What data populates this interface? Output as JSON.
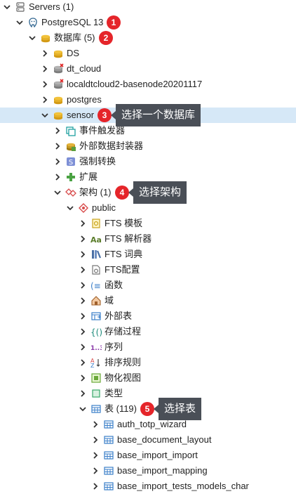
{
  "rows": [
    {
      "label": "Servers (1)",
      "icon": "servers-icon",
      "level": 0,
      "chev": "down"
    },
    {
      "label": "PostgreSQL 13",
      "icon": "postgresql-server-icon",
      "level": 1,
      "chev": "down"
    },
    {
      "label": "数据库 (5)",
      "icon": "databases-icon",
      "level": 2,
      "chev": "down"
    },
    {
      "label": "DS",
      "icon": "database-icon",
      "level": 3,
      "chev": "right"
    },
    {
      "label": "dt_cloud",
      "icon": "database-disconnected-icon",
      "level": 3,
      "chev": "right"
    },
    {
      "label": "localdtcloud2-basenode20201117",
      "icon": "database-disconnected-icon",
      "level": 3,
      "chev": "right"
    },
    {
      "label": "postgres",
      "icon": "database-icon",
      "level": 3,
      "chev": "right"
    },
    {
      "label": "sensor",
      "icon": "database-icon",
      "level": 3,
      "chev": "down",
      "selected": true
    },
    {
      "label": "事件触发器",
      "icon": "event-trigger-icon",
      "level": 4,
      "chev": "right"
    },
    {
      "label": "外部数据封装器",
      "icon": "foreign-data-wrapper-icon",
      "level": 4,
      "chev": "right"
    },
    {
      "label": "强制转换",
      "icon": "cast-icon",
      "level": 4,
      "chev": "right"
    },
    {
      "label": "扩展",
      "icon": "extension-icon",
      "level": 4,
      "chev": "right"
    },
    {
      "label": "架构 (1)",
      "icon": "schemas-icon",
      "level": 4,
      "chev": "down"
    },
    {
      "label": "public",
      "icon": "schema-icon",
      "level": 5,
      "chev": "down"
    },
    {
      "label": "FTS 模板",
      "icon": "fts-template-icon",
      "level": 6,
      "chev": "right"
    },
    {
      "label": "FTS 解析器",
      "icon": "fts-parser-icon",
      "level": 6,
      "chev": "right"
    },
    {
      "label": "FTS 词典",
      "icon": "fts-dictionary-icon",
      "level": 6,
      "chev": "right"
    },
    {
      "label": "FTS配置",
      "icon": "fts-configuration-icon",
      "level": 6,
      "chev": "right"
    },
    {
      "label": "函数",
      "icon": "function-icon",
      "level": 6,
      "chev": "right"
    },
    {
      "label": "域",
      "icon": "domain-icon",
      "level": 6,
      "chev": "right"
    },
    {
      "label": "外部表",
      "icon": "foreign-table-icon",
      "level": 6,
      "chev": "right"
    },
    {
      "label": "存储过程",
      "icon": "procedure-icon",
      "level": 6,
      "chev": "right"
    },
    {
      "label": "序列",
      "icon": "sequence-icon",
      "level": 6,
      "chev": "right"
    },
    {
      "label": "排序规则",
      "icon": "collation-icon",
      "level": 6,
      "chev": "right"
    },
    {
      "label": "物化视图",
      "icon": "materialized-view-icon",
      "level": 6,
      "chev": "right"
    },
    {
      "label": "类型",
      "icon": "type-icon",
      "level": 6,
      "chev": "right"
    },
    {
      "label": "表 (119)",
      "icon": "tables-icon",
      "level": 6,
      "chev": "down"
    },
    {
      "label": "auth_totp_wizard",
      "icon": "table-icon",
      "level": 7,
      "chev": "right"
    },
    {
      "label": "base_document_layout",
      "icon": "table-icon",
      "level": 7,
      "chev": "right"
    },
    {
      "label": "base_import_import",
      "icon": "table-icon",
      "level": 7,
      "chev": "right"
    },
    {
      "label": "base_import_mapping",
      "icon": "table-icon",
      "level": 7,
      "chev": "right"
    },
    {
      "label": "base_import_tests_models_char",
      "icon": "table-icon",
      "level": 7,
      "chev": "right"
    }
  ],
  "badges": [
    {
      "num": "1",
      "row": 1
    },
    {
      "num": "2",
      "row": 2
    },
    {
      "num": "3",
      "row": 7
    },
    {
      "num": "4",
      "row": 12
    },
    {
      "num": "5",
      "row": 26
    }
  ],
  "callouts": [
    {
      "text": "选择一个数据库",
      "row": 7
    },
    {
      "text": "选择架构",
      "row": 12
    },
    {
      "text": "选择表",
      "row": 26
    }
  ]
}
